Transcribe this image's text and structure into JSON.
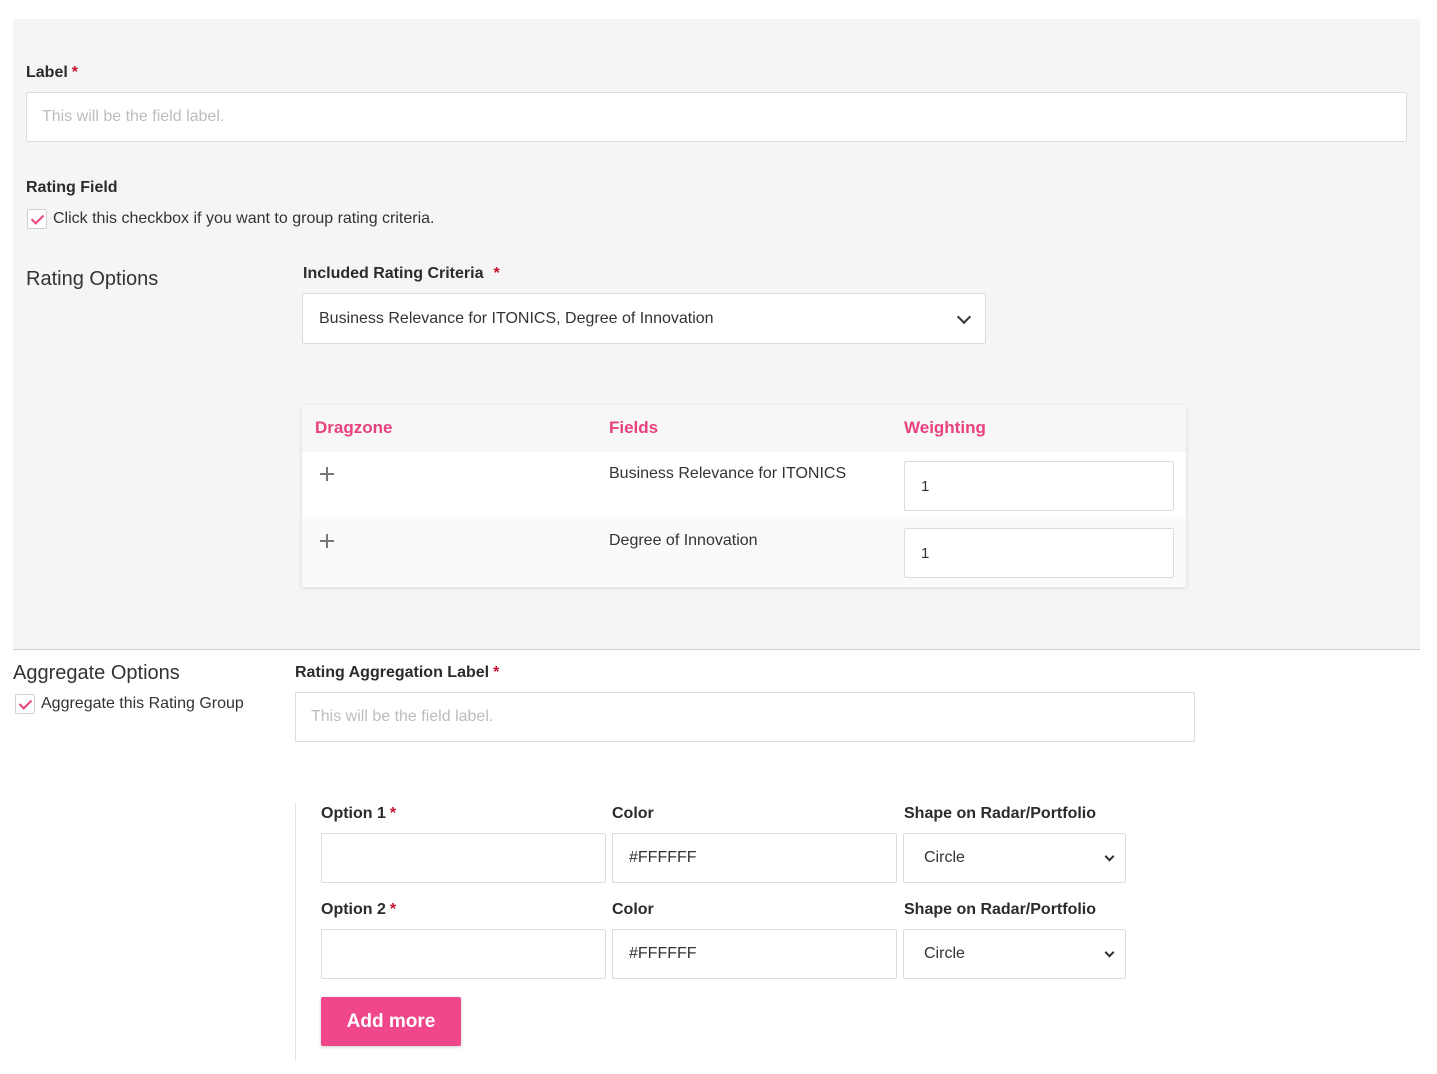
{
  "label_field": {
    "label": "Label",
    "required_mark": "*",
    "placeholder": "This will be the field label."
  },
  "rating_field": {
    "title": "Rating Field",
    "checkbox_text": "Click this checkbox if you want to group rating criteria.",
    "checked": true
  },
  "rating_options": {
    "title": "Rating Options",
    "criteria_label": "Included Rating Criteria",
    "required_mark": "*",
    "criteria_value": "Business Relevance for ITONICS, Degree of Innovation",
    "table": {
      "headers": [
        "Dragzone",
        "Fields",
        "Weighting"
      ],
      "rows": [
        {
          "field": "Business Relevance for ITONICS",
          "weight": "1"
        },
        {
          "field": "Degree of Innovation",
          "weight": "1"
        }
      ]
    }
  },
  "aggregate": {
    "title": "Aggregate Options",
    "checkbox_text": "Aggregate this Rating Group",
    "checked": true,
    "label": "Rating Aggregation Label",
    "required_mark": "*",
    "placeholder": "This will be the field label."
  },
  "options": [
    {
      "label": "Option 1",
      "required_mark": "*",
      "value": "",
      "color_label": "Color",
      "color": "#FFFFFF",
      "shape_label": "Shape on Radar/Portfolio",
      "shape": "Circle"
    },
    {
      "label": "Option 2",
      "required_mark": "*",
      "value": "",
      "color_label": "Color",
      "color": "#FFFFFF",
      "shape_label": "Shape on Radar/Portfolio",
      "shape": "Circle"
    }
  ],
  "add_more_label": "Add more",
  "colors": {
    "accent": "#e8417e",
    "button": "#f0468a",
    "required": "#c8102e",
    "panel_bg": "#f5f5f5"
  }
}
